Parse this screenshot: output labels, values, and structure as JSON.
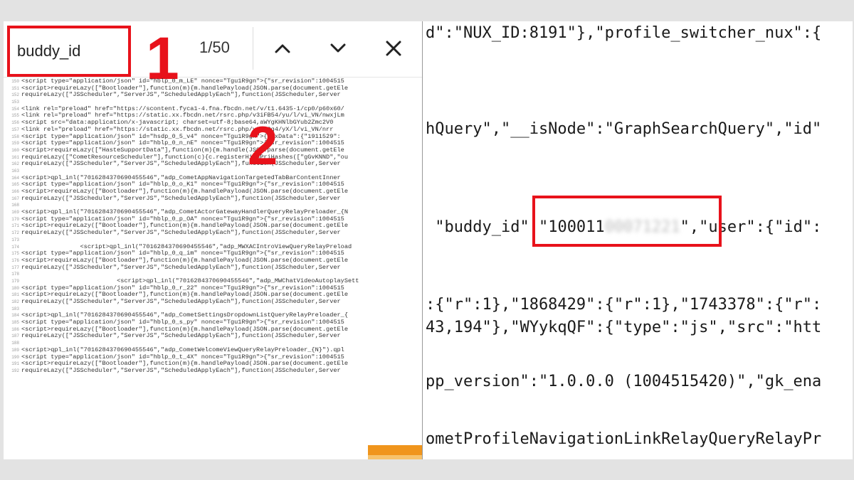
{
  "search": {
    "query": "buddy_id",
    "match_count": "1/50"
  },
  "steps": {
    "first": "1",
    "second": "2"
  },
  "source_lines": [
    {
      "n": "150",
      "t": "<script type=\"application/json\" id=\"hblp_0_m_LE\" nonce=\"Tgu1R9gn\">{\"sr_revision\":1004515"
    },
    {
      "n": "151",
      "t": "<script>requireLazy([\"Bootloader\"],function(m){m.handlePayload(JSON.parse(document.getEle"
    },
    {
      "n": "152",
      "t": "requireLazy([\"JSScheduler\",\"ServerJS\",\"ScheduledApplyEach\"],function(JSScheduler,Server"
    },
    {
      "n": "153",
      "t": ""
    },
    {
      "n": "154",
      "t": "<link rel=\"preload\" href=\"https://scontent.fyca1-4.fna.fbcdn.net/v/t1.6435-1/cp0/p60x60/"
    },
    {
      "n": "155",
      "t": "<link rel=\"preload\" href=\"https://static.xx.fbcdn.net/rsrc.php/v3iFB54/yu/l/vi_VN/nwxjLm"
    },
    {
      "n": "156",
      "t": "<script src=\"data:application/x-javascript; charset=utf-8;base64,aWYgKHNlbGYub2Zmc2V0"
    },
    {
      "n": "157",
      "t": "<link rel=\"preload\" href=\"https://static.xx.fbcdn.net/rsrc.php/v3iOOg4/yX/l/vi_VN/nrr"
    },
    {
      "n": "158",
      "t": "<script type=\"application/json\" id=\"hsdp_0_5_v4\" nonce=\"Tgu1R9gn\">{\"bxData\":{\"1911529\":"
    },
    {
      "n": "159",
      "t": "<script type=\"application/json\" id=\"hblp_0_n_nE\" nonce=\"Tgu1R9gn\">{\"sr_revision\":1004515"
    },
    {
      "n": "160",
      "t": "<script>requireLazy([\"HasteSupportData\"],function(m){m.handle(JSON.parse(document.getEle"
    },
    {
      "n": "161",
      "t": "requireLazy([\"CometResourceScheduler\"],function(c){c.registerHighPriHashes([\"gGvKNND\",\"ou"
    },
    {
      "n": "162",
      "t": "requireLazy([\"JSScheduler\",\"ServerJS\",\"ScheduledApplyEach\"],function(JSScheduler,Server"
    },
    {
      "n": "163",
      "t": ""
    },
    {
      "n": "164",
      "t": "<script>qpl_inl(\"7016284370690455546\",\"adp_CometAppNavigationTargetedTabBarContentInner"
    },
    {
      "n": "165",
      "t": "<script type=\"application/json\" id=\"hblp_0_o_K1\" nonce=\"Tgu1R9gn\">{\"sr_revision\":1004515"
    },
    {
      "n": "166",
      "t": "<script>requireLazy([\"Bootloader\"],function(m){m.handlePayload(JSON.parse(document.getEle"
    },
    {
      "n": "167",
      "t": "requireLazy([\"JSScheduler\",\"ServerJS\",\"ScheduledApplyEach\"],function(JSScheduler,Server"
    },
    {
      "n": "168",
      "t": ""
    },
    {
      "n": "169",
      "t": "<script>qpl_inl(\"7016284370690455546\",\"adp_CometActorGatewayHandlerQueryRelayPreloader_{N"
    },
    {
      "n": "170",
      "t": "<script type=\"application/json\" id=\"hblp_0_p_OA\" nonce=\"Tgu1R9gn\">{\"sr_revision\":1004515"
    },
    {
      "n": "171",
      "t": "<script>requireLazy([\"Bootloader\"],function(m){m.handlePayload(JSON.parse(document.getEle"
    },
    {
      "n": "172",
      "t": "requireLazy([\"JSScheduler\",\"ServerJS\",\"ScheduledApplyEach\"],function(JSScheduler,Server"
    },
    {
      "n": "173",
      "t": ""
    },
    {
      "n": "174",
      "t": "                <script>qpl_inl(\"7016284370690455546\",\"adp_MWXACIntroViewQueryRelayPreload"
    },
    {
      "n": "175",
      "t": "<script type=\"application/json\" id=\"hblp_0_q_im\" nonce=\"Tgu1R9gn\">{\"sr_revision\":1004515"
    },
    {
      "n": "176",
      "t": "<script>requireLazy([\"Bootloader\"],function(m){m.handlePayload(JSON.parse(document.getEle"
    },
    {
      "n": "177",
      "t": "requireLazy([\"JSScheduler\",\"ServerJS\",\"ScheduledApplyEach\"],function(JSScheduler,Server"
    },
    {
      "n": "178",
      "t": ""
    },
    {
      "n": "179",
      "t": "                          <script>qpl_inl(\"7016284370690455546\",\"adp_MWChatVideoAutoplaySett"
    },
    {
      "n": "180",
      "t": "<script type=\"application/json\" id=\"hblp_0_r_22\" nonce=\"Tgu1R9gn\">{\"sr_revision\":1004515"
    },
    {
      "n": "181",
      "t": "<script>requireLazy([\"Bootloader\"],function(m){m.handlePayload(JSON.parse(document.getEle"
    },
    {
      "n": "182",
      "t": "requireLazy([\"JSScheduler\",\"ServerJS\",\"ScheduledApplyEach\"],function(JSScheduler,Server"
    },
    {
      "n": "183",
      "t": ""
    },
    {
      "n": "184",
      "t": "<script>qpl_inl(\"7016284370690455546\",\"adp_CometSettingsDropdownListQueryRelayPreloader_{"
    },
    {
      "n": "185",
      "t": "<script type=\"application/json\" id=\"hblp_0_s_py\" nonce=\"Tgu1R9gn\">{\"sr_revision\":1004515"
    },
    {
      "n": "186",
      "t": "<script>requireLazy([\"Bootloader\"],function(m){m.handlePayload(JSON.parse(document.getEle"
    },
    {
      "n": "187",
      "t": "requireLazy([\"JSScheduler\",\"ServerJS\",\"ScheduledApplyEach\"],function(JSScheduler,Server"
    },
    {
      "n": "188",
      "t": ""
    },
    {
      "n": "189",
      "t": "<script>qpl_inl(\"7016284370690455546\",\"adp_CometWelcomeViewQueryRelayPreloader_{N}\").qpl"
    },
    {
      "n": "190",
      "t": "<script type=\"application/json\" id=\"hblp_0_t_4X\" nonce=\"Tgu1R9gn\">{\"sr_revision\":1004515"
    },
    {
      "n": "191",
      "t": "<script>requireLazy([\"Bootloader\"],function(m){m.handlePayload(JSON.parse(document.getEle"
    },
    {
      "n": "192",
      "t": "requireLazy([\"JSScheduler\",\"ServerJS\",\"ScheduledApplyEach\"],function(JSScheduler,Server"
    }
  ],
  "zoomed": {
    "line1": "d\":\"NUX_ID:8191\"},\"profile_switcher_nux\":{",
    "line2": "hQuery\",\"__isNode\":\"GraphSearchQuery\",\"id\"",
    "line3_key": " \"buddy_id\" ",
    "line3_value_visible": "\"100011",
    "line3_value_hidden": "00071221",
    "line3_end": "\",\"user\":{\"id\":",
    "line4": ":{\"r\":1},\"1868429\":{\"r\":1},\"1743378\":{\"r\":",
    "line5": "43,194\"},\"WYykqQF\":{\"type\":\"js\",\"src\":\"htt",
    "line6": "pp_version\":\"1.0.0.0 (1004515420)\",\"gk_ena",
    "line7": "ometProfileNavigationLinkRelayQueryRelayPr"
  },
  "colors": {
    "highlight": "#e8121b",
    "scroll_thumb": "#f0951c"
  },
  "icons": {
    "up": "chevron-up-icon",
    "down": "chevron-down-icon",
    "close": "close-icon"
  }
}
